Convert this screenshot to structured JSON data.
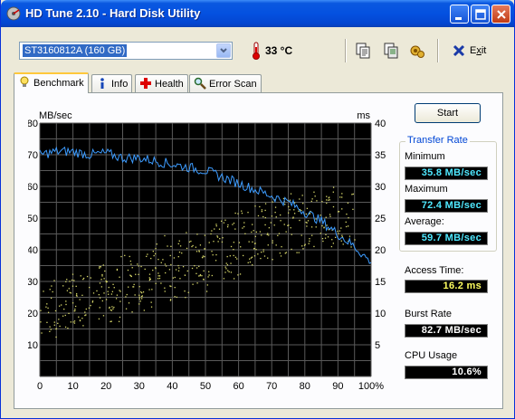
{
  "window": {
    "title": "HD Tune 2.10 - Hard Disk Utility"
  },
  "toolbar": {
    "drive": "ST3160812A (160 GB)",
    "temperature": "33 °C",
    "exit_label": "Exit",
    "exit_accel_prefix": "E",
    "exit_accel_char": "x",
    "exit_rest": "it"
  },
  "tabs": [
    {
      "label": "Benchmark",
      "active": true
    },
    {
      "label": "Info",
      "active": false
    },
    {
      "label": "Health",
      "active": false
    },
    {
      "label": "Error Scan",
      "active": false
    }
  ],
  "controls": {
    "start_label": "Start"
  },
  "results": {
    "transfer_rate_title": "Transfer Rate",
    "minimum_label": "Minimum",
    "minimum_value": "35.8 MB/sec",
    "maximum_label": "Maximum",
    "maximum_value": "72.4 MB/sec",
    "average_label": "Average:",
    "average_value": "59.7 MB/sec",
    "access_time_label": "Access Time:",
    "access_time_value": "16.2 ms",
    "burst_rate_label": "Burst Rate",
    "burst_rate_value": "82.7 MB/sec",
    "cpu_usage_label": "CPU Usage",
    "cpu_usage_value": "10.6%"
  },
  "colors": {
    "plot_bg": "#000000",
    "grid": "#5a5a5a",
    "transfer_line": "#3d9cff",
    "access_dots": "#d8d86a",
    "cyan_value": "#4fe8ff",
    "yellow_value": "#ffff60"
  },
  "chart_data": {
    "type": "line",
    "title": "",
    "left_axis_label": "MB/sec",
    "right_axis_label": "ms",
    "x_ticks": [
      "0",
      "10",
      "20",
      "30",
      "40",
      "50",
      "60",
      "70",
      "80",
      "90",
      "100%"
    ],
    "left_ticks": [
      "10",
      "20",
      "30",
      "40",
      "50",
      "60",
      "70",
      "80"
    ],
    "right_ticks": [
      "5",
      "10",
      "15",
      "20",
      "25",
      "30",
      "35",
      "40"
    ],
    "xlim": [
      0,
      100
    ],
    "ylim_left": [
      0,
      80
    ],
    "ylim_right": [
      0,
      40
    ],
    "grid": true,
    "series": [
      {
        "name": "Transfer Rate",
        "axis": "left",
        "x": [
          0,
          5,
          10,
          15,
          20,
          25,
          30,
          35,
          40,
          45,
          50,
          55,
          60,
          65,
          70,
          75,
          80,
          85,
          90,
          95,
          100
        ],
        "y": [
          70,
          71,
          71,
          70,
          70.5,
          69,
          69,
          68,
          67,
          66,
          65,
          63,
          61,
          59,
          57,
          55,
          52,
          49,
          45,
          41,
          36
        ]
      },
      {
        "name": "Access Time",
        "axis": "right",
        "style": "scatter",
        "x": [
          2,
          5,
          8,
          10,
          12,
          15,
          18,
          20,
          22,
          25,
          28,
          30,
          33,
          35,
          38,
          40,
          43,
          45,
          48,
          50,
          53,
          55,
          58,
          60,
          63,
          65,
          68,
          70,
          73,
          75,
          78,
          80,
          83,
          85,
          88,
          90,
          93
        ],
        "y": [
          11,
          10,
          12,
          11,
          13,
          12,
          13,
          14,
          13,
          15,
          14,
          16,
          15,
          17,
          16,
          18,
          17,
          19,
          18,
          19,
          20,
          21,
          20,
          22,
          21,
          23,
          22,
          24,
          23,
          24,
          25,
          24,
          25,
          26,
          25,
          26,
          25
        ]
      }
    ]
  }
}
